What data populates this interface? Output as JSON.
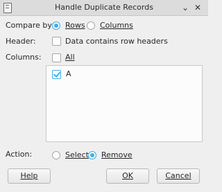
{
  "window": {
    "title": "Handle Duplicate Records"
  },
  "compare_by": {
    "label": "Compare by:",
    "options": [
      {
        "label": "Rows",
        "selected": true
      },
      {
        "label": "Columns",
        "selected": false
      }
    ]
  },
  "header": {
    "label": "Header:",
    "checkbox_label": "Data contains row headers",
    "checked": false
  },
  "columns": {
    "label": "Columns:",
    "all_label": "All",
    "all_checked": false,
    "items": [
      {
        "label": "A",
        "checked": true
      }
    ]
  },
  "action": {
    "label": "Action:",
    "options": [
      {
        "label": "Select",
        "selected": false
      },
      {
        "label": "Remove",
        "selected": true
      }
    ]
  },
  "buttons": {
    "help": "Help",
    "ok": "OK",
    "cancel": "Cancel"
  },
  "colors": {
    "accent": "#3daee9",
    "window_bg": "#efefef",
    "titlebar_bg": "#dcdcdc"
  },
  "icons": {
    "app": "document-icon",
    "minimize": "chevron-down-icon",
    "close": "close-icon"
  }
}
